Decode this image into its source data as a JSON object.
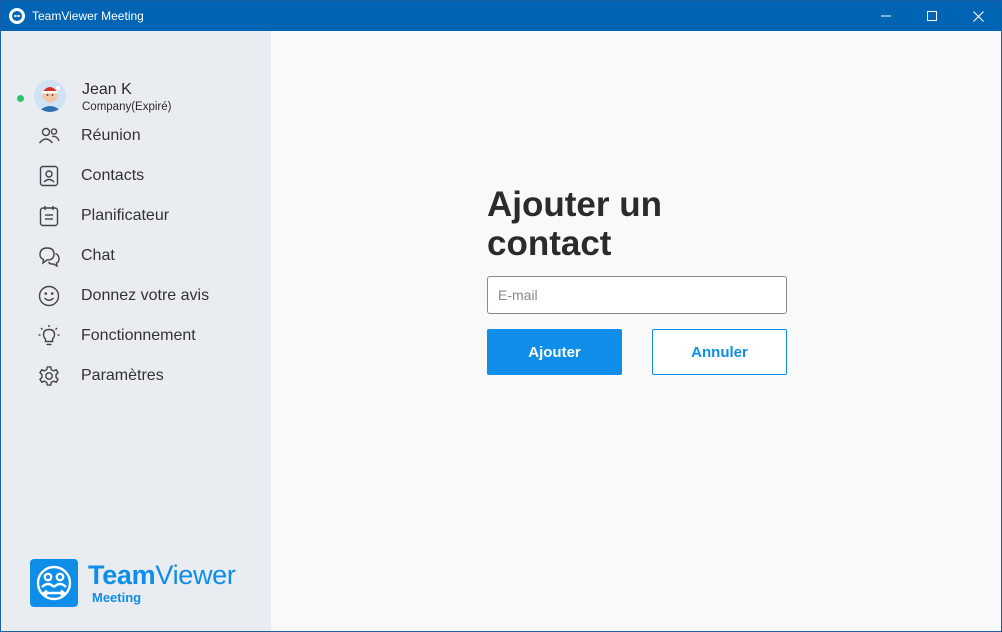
{
  "window": {
    "title": "TeamViewer Meeting"
  },
  "titlebar": {
    "minimize_icon": "minimize-icon",
    "maximize_icon": "maximize-icon",
    "close_icon": "close-icon"
  },
  "user": {
    "name": "Jean K",
    "company": "Company(Expiré)",
    "status": "online"
  },
  "nav": {
    "items": [
      {
        "label": "Réunion",
        "icon": "people-icon"
      },
      {
        "label": "Contacts",
        "icon": "contact-card-icon"
      },
      {
        "label": "Planificateur",
        "icon": "calendar-icon"
      },
      {
        "label": "Chat",
        "icon": "chat-bubbles-icon"
      },
      {
        "label": "Donnez votre avis",
        "icon": "smiley-icon"
      },
      {
        "label": "Fonctionnement",
        "icon": "lightbulb-icon"
      },
      {
        "label": "Paramètres",
        "icon": "gear-icon"
      }
    ]
  },
  "logo": {
    "brand_bold": "Team",
    "brand_regular": "Viewer",
    "product": "Meeting"
  },
  "form": {
    "heading": "Ajouter un contact",
    "email_placeholder": "E-mail",
    "email_value": "",
    "add_label": "Ajouter",
    "cancel_label": "Annuler"
  },
  "colors": {
    "titlebar": "#0064b4",
    "accent": "#0e8ee9",
    "sidebar": "#e9ecf1",
    "status_online": "#2dc26b"
  }
}
